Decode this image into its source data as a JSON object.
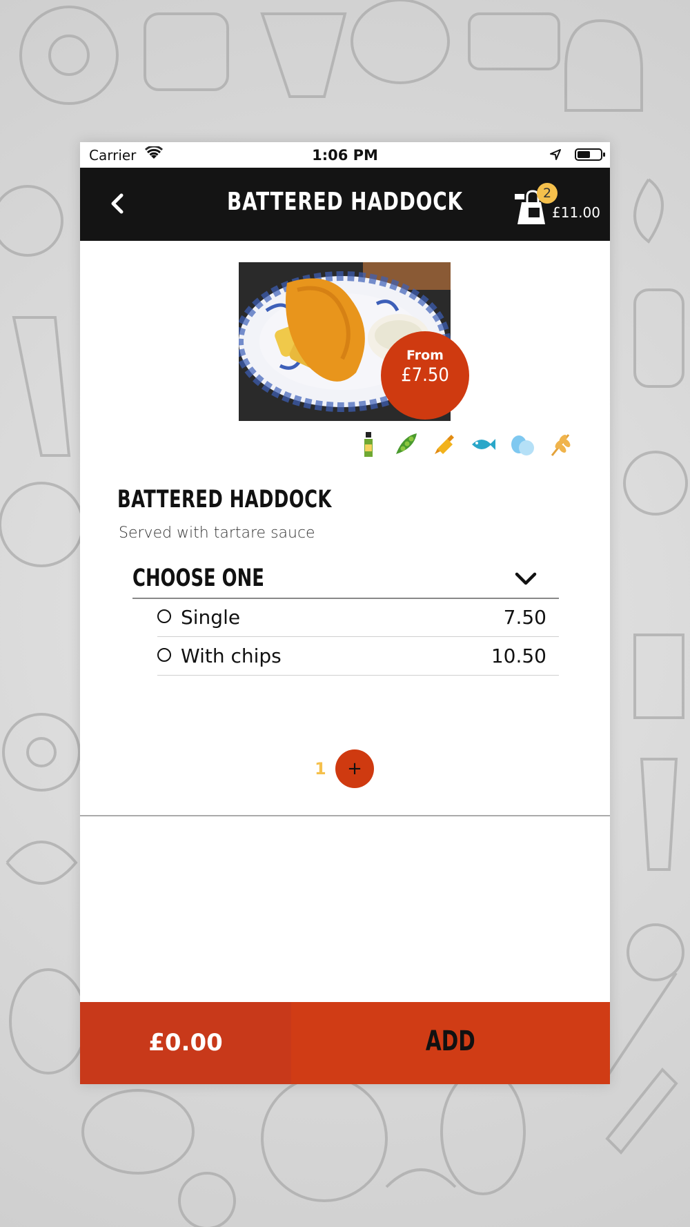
{
  "status_bar": {
    "carrier": "Carrier",
    "time": "1:06 PM"
  },
  "navbar": {
    "title": "BATTERED HADDOCK",
    "back_icon": "chevron-left-icon"
  },
  "cart": {
    "count": "2",
    "total": "£11.00",
    "icon": "shopping-bag-icon"
  },
  "product": {
    "price_from_label": "From",
    "price_from_value": "£7.50",
    "title": "BATTERED HADDOCK",
    "description": "Served with tartare sauce",
    "allergens": [
      "celery-icon",
      "soya-icon",
      "mustard-icon",
      "fish-icon",
      "eggs-icon",
      "gluten-icon"
    ]
  },
  "options": {
    "header": "CHOOSE ONE",
    "items": [
      {
        "name": "Single",
        "price": "7.50"
      },
      {
        "name": "With chips",
        "price": "10.50"
      }
    ]
  },
  "quantity": {
    "value": "1",
    "plus_label": "+"
  },
  "footer": {
    "total": "£0.00",
    "add_label": "ADD"
  },
  "colors": {
    "accent": "#d03c15",
    "badge": "#f5c04c",
    "navbar": "#141414"
  }
}
